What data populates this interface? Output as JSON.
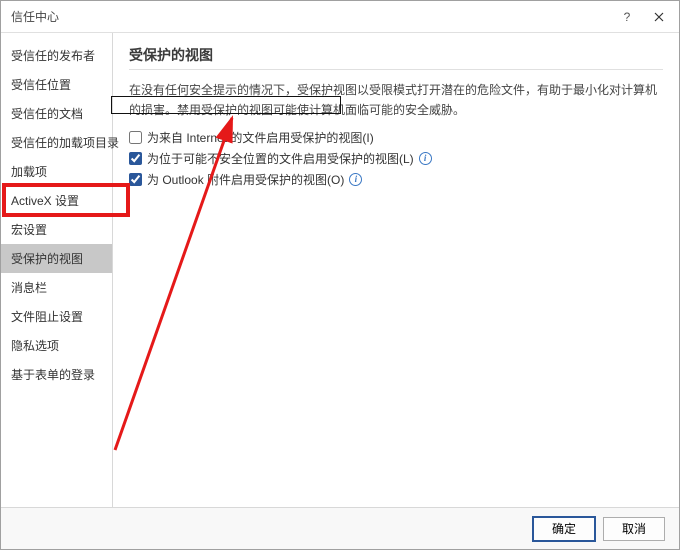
{
  "titlebar": {
    "title": "信任中心"
  },
  "sidebar": {
    "items": [
      {
        "label": "受信任的发布者"
      },
      {
        "label": "受信任位置"
      },
      {
        "label": "受信任的文档"
      },
      {
        "label": "受信任的加载项目录"
      },
      {
        "label": "加载项"
      },
      {
        "label": "ActiveX 设置"
      },
      {
        "label": "宏设置"
      },
      {
        "label": "受保护的视图",
        "active": true
      },
      {
        "label": "消息栏"
      },
      {
        "label": "文件阻止设置"
      },
      {
        "label": "隐私选项"
      },
      {
        "label": "基于表单的登录"
      }
    ]
  },
  "content": {
    "section_title": "受保护的视图",
    "description": "在没有任何安全提示的情况下，受保护视图以受限模式打开潜在的危险文件，有助于最小化对计算机的损害。禁用受保护的视图可能使计算机面临可能的安全威胁。",
    "options": [
      {
        "label": "为来自 Internet 的文件启用受保护的视图(I)",
        "checked": false,
        "info": false
      },
      {
        "label": "为位于可能不安全位置的文件启用受保护的视图(L)",
        "checked": true,
        "info": true
      },
      {
        "label": "为 Outlook 附件启用受保护的视图(O)",
        "checked": true,
        "info": true
      }
    ]
  },
  "footer": {
    "ok": "确定",
    "cancel": "取消"
  },
  "annotations": {
    "red_box_color": "#e51919",
    "arrow_color": "#e51919"
  }
}
